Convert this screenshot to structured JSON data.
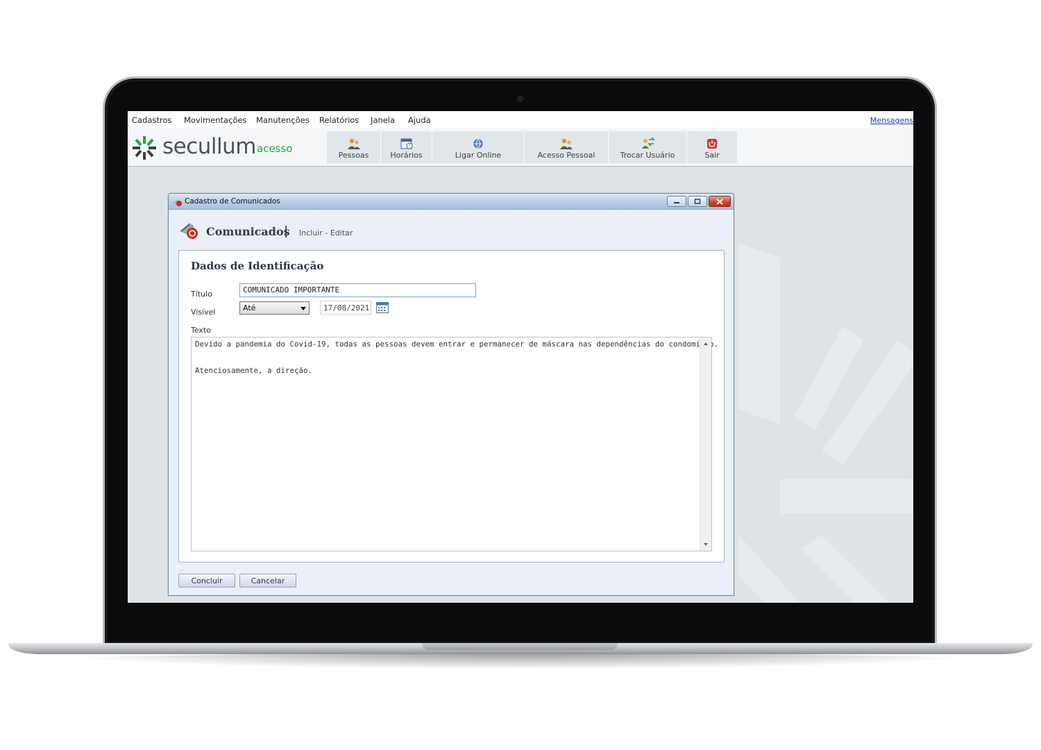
{
  "menubar": {
    "items": [
      "Cadastros",
      "Movimentações",
      "Manutenções",
      "Relatórios",
      "Janela",
      "Ajuda"
    ],
    "messages_link": "Mensagens"
  },
  "logo": {
    "brand": "secullum",
    "product": "acesso"
  },
  "toolbar": {
    "buttons": [
      {
        "label": "Pessoas",
        "icon": "people-icon"
      },
      {
        "label": "Horários",
        "icon": "schedule-icon"
      },
      {
        "label": "Ligar Online",
        "icon": "online-globe-icon"
      },
      {
        "label": "Acesso Pessoal",
        "icon": "personal-access-icon"
      },
      {
        "label": "Trocar Usuário",
        "icon": "switch-user-icon"
      },
      {
        "label": "Sair",
        "icon": "power-icon"
      }
    ]
  },
  "dialog": {
    "window_title": "Cadastro de Comunicados",
    "header_title": "Comunicados",
    "header_separator": "|",
    "header_subtitle": "Incluir - Editar",
    "section_title": "Dados de Identificação",
    "fields": {
      "titulo_label": "Título",
      "titulo_value": "COMUNICADO IMPORTANTE",
      "visivel_label": "Visível",
      "visivel_option": "Até",
      "visivel_date": "17/08/2021",
      "texto_label": "Texto",
      "texto_lines": [
        "Devido a pandemia do Covid-19, todas as pessoas devem entrar e permanecer de máscara nas dependências do condomínio.",
        "",
        "Atenciosamente, a direção."
      ]
    },
    "buttons": {
      "confirm": "Concluir",
      "cancel": "Cancelar"
    }
  },
  "colors": {
    "brand_green": "#25a83e",
    "title_bar": "#b9cde5",
    "close_button": "#c9422c",
    "link_blue": "#1a3fb0"
  }
}
